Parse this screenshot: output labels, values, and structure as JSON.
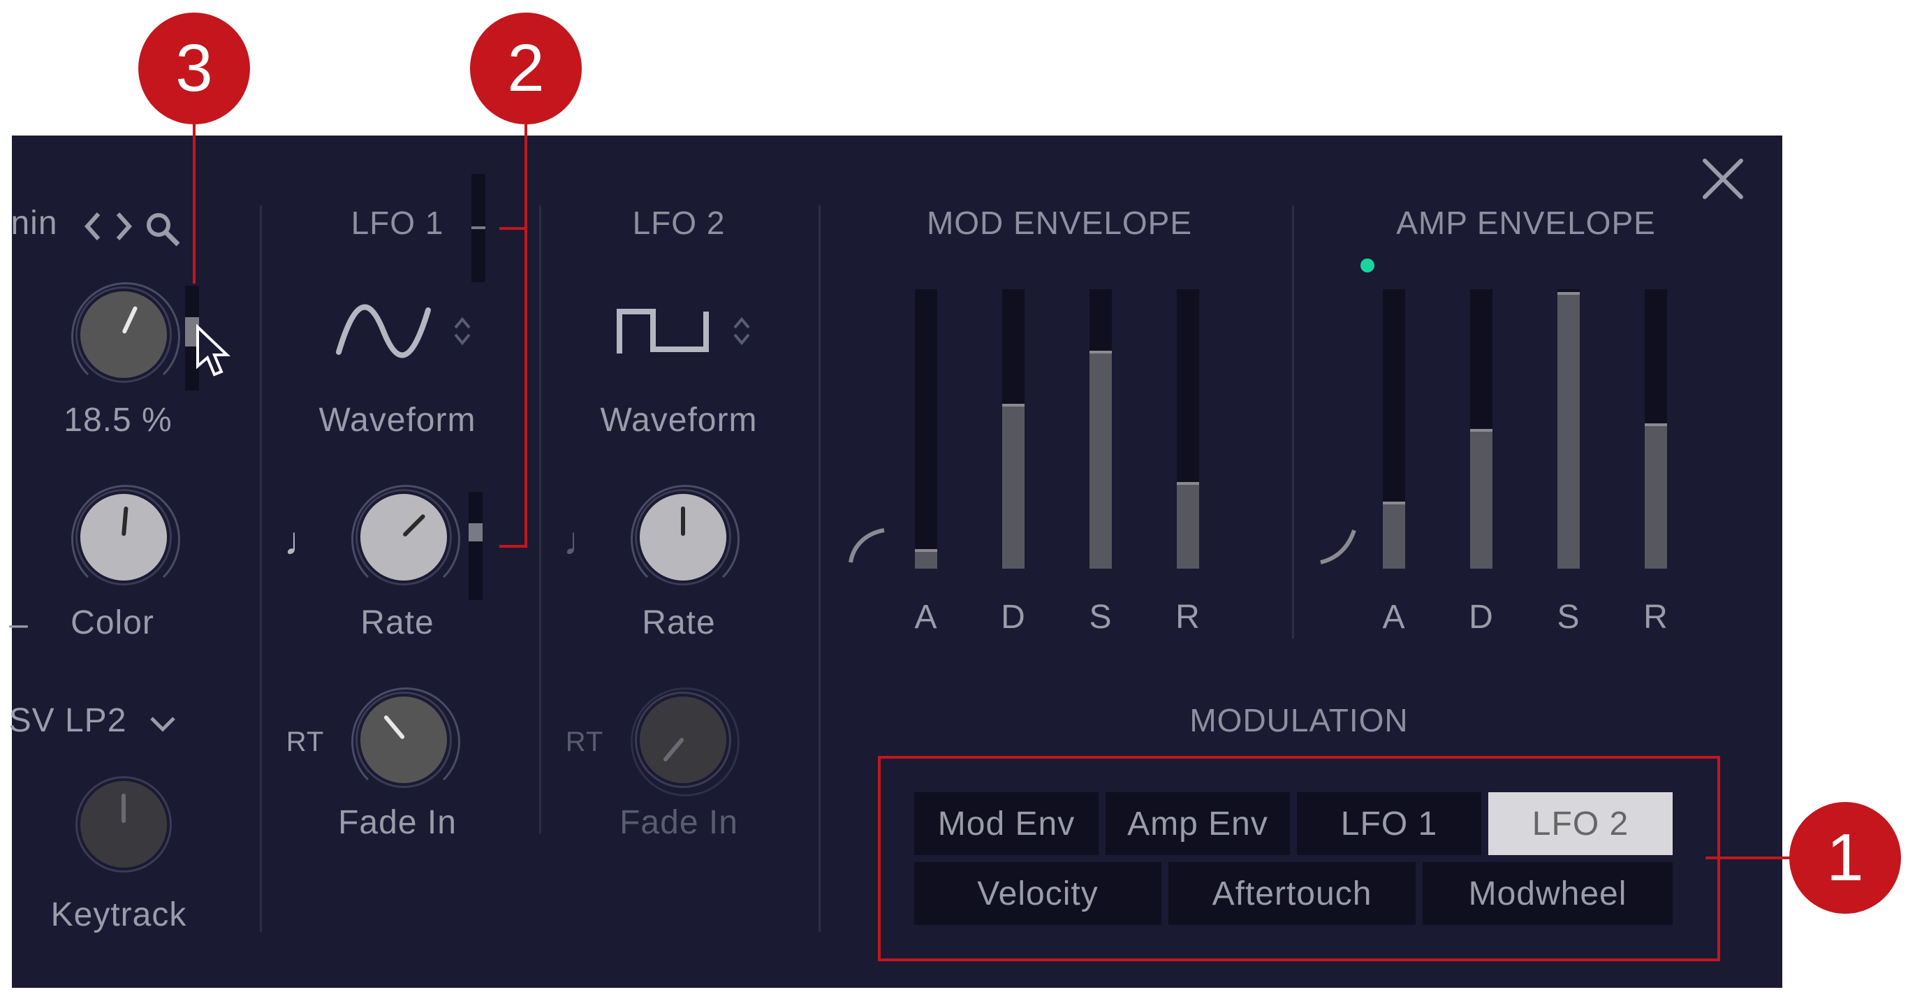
{
  "callouts": {
    "c1": "1",
    "c2": "2",
    "c3": "3"
  },
  "left": {
    "header_text": "nin",
    "nav_icons": "< >",
    "value": "18.5 %",
    "color_label": "Color",
    "filter_type": "SV LP2",
    "keytrack_label": "Keytrack",
    "dash": "–"
  },
  "lfo1": {
    "title": "LFO 1",
    "waveform_label": "Waveform",
    "rate_label": "Rate",
    "rt_label": "RT",
    "fade_label": "Fade In",
    "note_glyph": "♩"
  },
  "lfo2": {
    "title": "LFO 2",
    "waveform_label": "Waveform",
    "rate_label": "Rate",
    "rt_label": "RT",
    "fade_label": "Fade In",
    "note_glyph": "♩"
  },
  "mod_env": {
    "title": "MOD ENVELOPE",
    "labels": [
      "A",
      "D",
      "S",
      "R"
    ],
    "levels": [
      0.07,
      0.59,
      0.78,
      0.31
    ]
  },
  "amp_env": {
    "title": "AMP ENVELOPE",
    "labels": [
      "A",
      "D",
      "S",
      "R"
    ],
    "levels": [
      0.24,
      0.5,
      0.99,
      0.52
    ]
  },
  "modulation": {
    "title": "MODULATION",
    "row1": [
      "Mod Env",
      "Amp Env",
      "LFO 1",
      "LFO 2"
    ],
    "row2": [
      "Velocity",
      "Aftertouch",
      "Modwheel"
    ],
    "selected": "LFO 2"
  },
  "colors": {
    "panel": "#1a1a33",
    "callout": "#c4161c",
    "indicator": "#19d49c"
  }
}
